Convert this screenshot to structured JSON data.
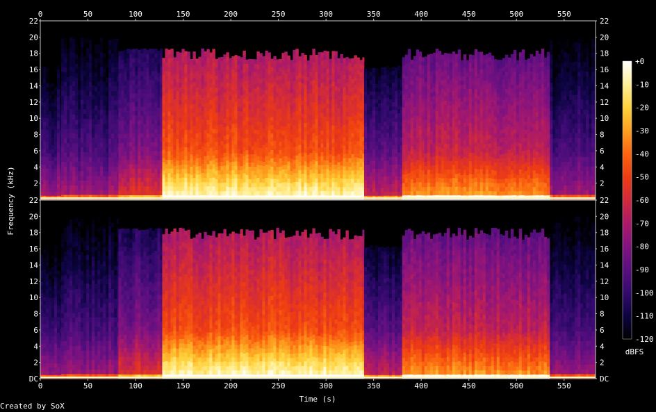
{
  "chart_data": {
    "type": "heatmap",
    "subtype": "spectrogram",
    "title": "",
    "xlabel": "Time (s)",
    "ylabel": "Frequency (kHz)",
    "xlim": [
      0,
      583
    ],
    "ylim": [
      0,
      22
    ],
    "x_ticks": [
      0,
      50,
      100,
      150,
      200,
      250,
      300,
      350,
      400,
      450,
      500,
      550
    ],
    "y_tick_labels_top": [
      "22",
      "20",
      "18",
      "16",
      "14",
      "12",
      "10",
      "8",
      "6",
      "4",
      "2"
    ],
    "y_tick_labels_bottom": [
      "22",
      "20",
      "18",
      "16",
      "14",
      "12",
      "10",
      "8",
      "6",
      "4",
      "2",
      "DC"
    ],
    "channels": [
      "left",
      "right"
    ],
    "colorbar": {
      "label": "dBFS",
      "ticks": [
        "+0",
        "-10",
        "-20",
        "-30",
        "-40",
        "-50",
        "-60",
        "-70",
        "-80",
        "-90",
        "-100",
        "-110",
        "-120"
      ],
      "range": [
        -120,
        0
      ],
      "colors": [
        "#000000",
        "#0c0440",
        "#330a6e",
        "#5a0f80",
        "#821380",
        "#ab1a68",
        "#d12a3c",
        "#ee3c12",
        "#fb6510",
        "#fda020",
        "#ffd23c",
        "#fff09a",
        "#ffffff"
      ]
    },
    "segments": [
      {
        "t_start": 0,
        "t_end": 22,
        "cutoff_khz": 16.5,
        "level": 0.3
      },
      {
        "t_start": 22,
        "t_end": 82,
        "cutoff_khz": 20.0,
        "level": 0.3
      },
      {
        "t_start": 82,
        "t_end": 128,
        "cutoff_khz": 18.6,
        "level": 0.42
      },
      {
        "t_start": 128,
        "t_end": 340,
        "cutoff_khz": 18.6,
        "level": 0.72
      },
      {
        "t_start": 340,
        "t_end": 380,
        "cutoff_khz": 16.5,
        "level": 0.36
      },
      {
        "t_start": 380,
        "t_end": 535,
        "cutoff_khz": 18.6,
        "level": 0.57
      },
      {
        "t_start": 535,
        "t_end": 583,
        "cutoff_khz": 20.0,
        "level": 0.3
      }
    ]
  },
  "footer": {
    "credit": "Created by SoX"
  }
}
